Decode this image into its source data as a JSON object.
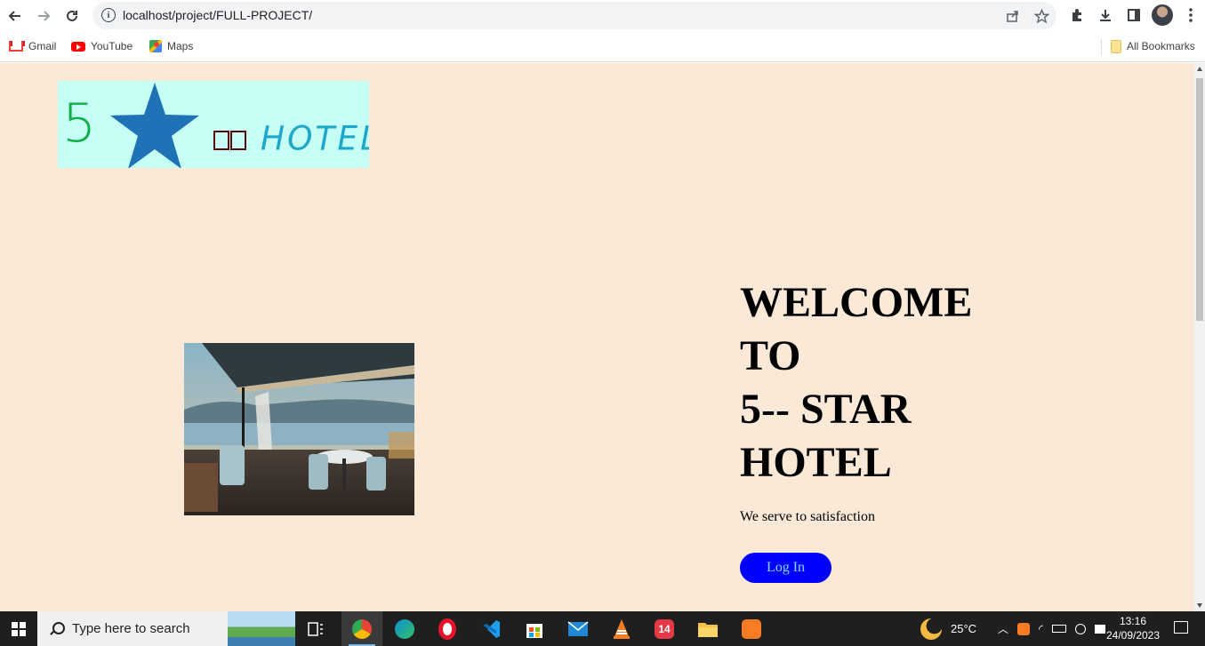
{
  "browser": {
    "url": "localhost/project/FULL-PROJECT/",
    "bookmarks": [
      {
        "label": "Gmail",
        "icon": "gmail-icon"
      },
      {
        "label": "YouTube",
        "icon": "youtube-icon"
      },
      {
        "label": "Maps",
        "icon": "maps-icon"
      }
    ],
    "all_bookmarks_label": "All Bookmarks"
  },
  "page": {
    "background_color": "#fae9d6",
    "logo": {
      "number": "5",
      "boxes": "□□",
      "word": "HOTEL",
      "colors": {
        "bg": "#c5fff6",
        "number": "#0fae48",
        "star": "#1f72b6",
        "word": "#1fa7c9"
      }
    },
    "welcome_lines": "WELCOME\nTO\n5-- STAR\nHOTEL",
    "tagline": "We serve to satisfaction",
    "login_label": "Log In",
    "login_colors": {
      "bg": "#0000ff",
      "text": "#7fdcff"
    }
  },
  "taskbar": {
    "search_placeholder": "Type here to search",
    "weather": "25°C",
    "time": "13:16",
    "date": "24/09/2023"
  }
}
